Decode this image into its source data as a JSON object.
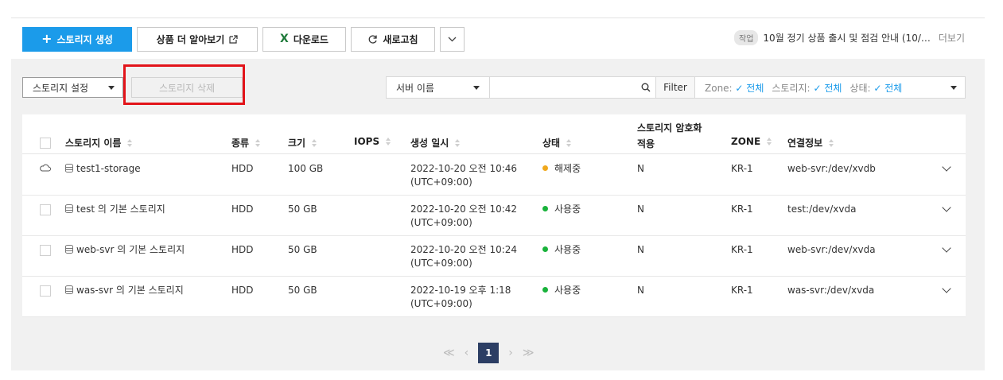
{
  "toolbar": {
    "create_label": "스토리지 생성",
    "learn_label": "상품 더 알아보기",
    "download_label": "다운로드",
    "refresh_label": "새로고침"
  },
  "notice": {
    "badge": "작업",
    "text": "10월 정기 상품 출시 및 점검 안내 (10/…",
    "more": "더보기"
  },
  "subbar": {
    "setting_label": "스토리지 설정",
    "delete_label": "스토리지 삭제",
    "search_type": "서버 이름",
    "search_value": "",
    "filter_label": "Filter",
    "filters": [
      {
        "key": "Zone:",
        "value": "전체"
      },
      {
        "key": "스토리지:",
        "value": "전체"
      },
      {
        "key": "상태:",
        "value": "전체"
      }
    ]
  },
  "table": {
    "headers": {
      "name": "스토리지 이름",
      "type": "종류",
      "size": "크기",
      "iops": "IOPS",
      "created": "생성 일시",
      "status": "상태",
      "encryption_1": "스토리지 암호화",
      "encryption_2": "적용",
      "zone": "ZONE",
      "connection": "연결정보"
    },
    "rows": [
      {
        "name": "test1-storage",
        "type": "HDD",
        "size": "100 GB",
        "iops": "",
        "created_1": "2022-10-20 오전 10:46",
        "created_2": "(UTC+09:00)",
        "status": "해제중",
        "status_color": "#f0a81c",
        "encryption": "N",
        "zone": "KR-1",
        "connection": "web-svr:/dev/xvdb"
      },
      {
        "name": "test 의 기본 스토리지",
        "type": "HDD",
        "size": "50 GB",
        "iops": "",
        "created_1": "2022-10-20 오전 10:42",
        "created_2": "(UTC+09:00)",
        "status": "사용중",
        "status_color": "#19b23b",
        "encryption": "N",
        "zone": "KR-1",
        "connection": "test:/dev/xvda"
      },
      {
        "name": "web-svr 의 기본 스토리지",
        "type": "HDD",
        "size": "50 GB",
        "iops": "",
        "created_1": "2022-10-20 오전 10:24",
        "created_2": "(UTC+09:00)",
        "status": "사용중",
        "status_color": "#19b23b",
        "encryption": "N",
        "zone": "KR-1",
        "connection": "web-svr:/dev/xvda"
      },
      {
        "name": "was-svr 의 기본 스토리지",
        "type": "HDD",
        "size": "50 GB",
        "iops": "",
        "created_1": "2022-10-19 오후 1:18",
        "created_2": "(UTC+09:00)",
        "status": "사용중",
        "status_color": "#19b23b",
        "encryption": "N",
        "zone": "KR-1",
        "connection": "was-svr:/dev/xvda"
      }
    ]
  },
  "pagination": {
    "first": "≪",
    "prev": "‹",
    "current": "1",
    "next": "›",
    "last": "≫"
  },
  "colors": {
    "primary": "#1b9bea",
    "highlight": "#e2141a",
    "page_active": "#2c3e64"
  }
}
